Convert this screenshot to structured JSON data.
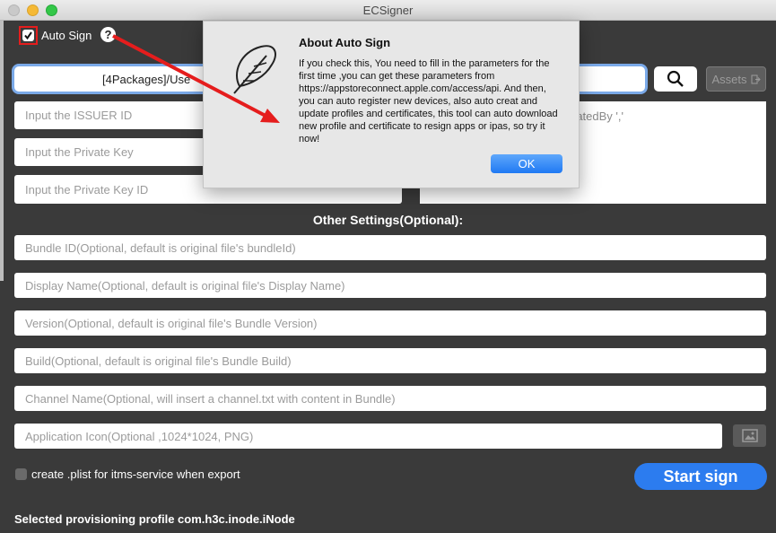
{
  "window": {
    "title": "ECSigner"
  },
  "autosign": {
    "label": "Auto Sign",
    "checked": true,
    "help_glyph": "?"
  },
  "path_bar": {
    "value": "[4Packages]/Use"
  },
  "assets_button": {
    "label": "Assets",
    "icon": "export-icon"
  },
  "inputs": {
    "issuer_id": "Input the ISSUER ID",
    "private_key": "Input the Private Key",
    "private_key_id": "Input the Private Key ID"
  },
  "textarea_partial": "ratedBy ','",
  "section_title": "Other Settings(Optional):",
  "optional": {
    "bundle_id": "Bundle ID(Optional, default is original file's bundleId)",
    "display_name": "Display Name(Optional, default is original file's Display Name)",
    "version": "Version(Optional, default is original file's Bundle Version)",
    "build": "Build(Optional, default is original file's Bundle Build)",
    "channel": "Channel Name(Optional, will insert a channel.txt with content in Bundle)",
    "app_icon": "Application Icon(Optional ,1024*1024, PNG)"
  },
  "plist": {
    "label": "create .plist for itms-service when export",
    "checked": false
  },
  "start_button": "Start sign",
  "status": "Selected provisioning profile com.h3c.inode.iNode",
  "dialog": {
    "title": "About Auto Sign",
    "message": "If you check this, You need to fill in the parameters for the first time ,you can get these parameters from https://appstoreconnect.apple.com/access/api. And then, you can auto register new devices, also auto creat and update profiles and certificates, this tool can auto download new profile and certificate to resign apps or ipas, so try it now!",
    "ok": "OK"
  },
  "colors": {
    "accent": "#2c7cef",
    "annotation": "#e51d1d",
    "background": "#3a3a3a"
  }
}
